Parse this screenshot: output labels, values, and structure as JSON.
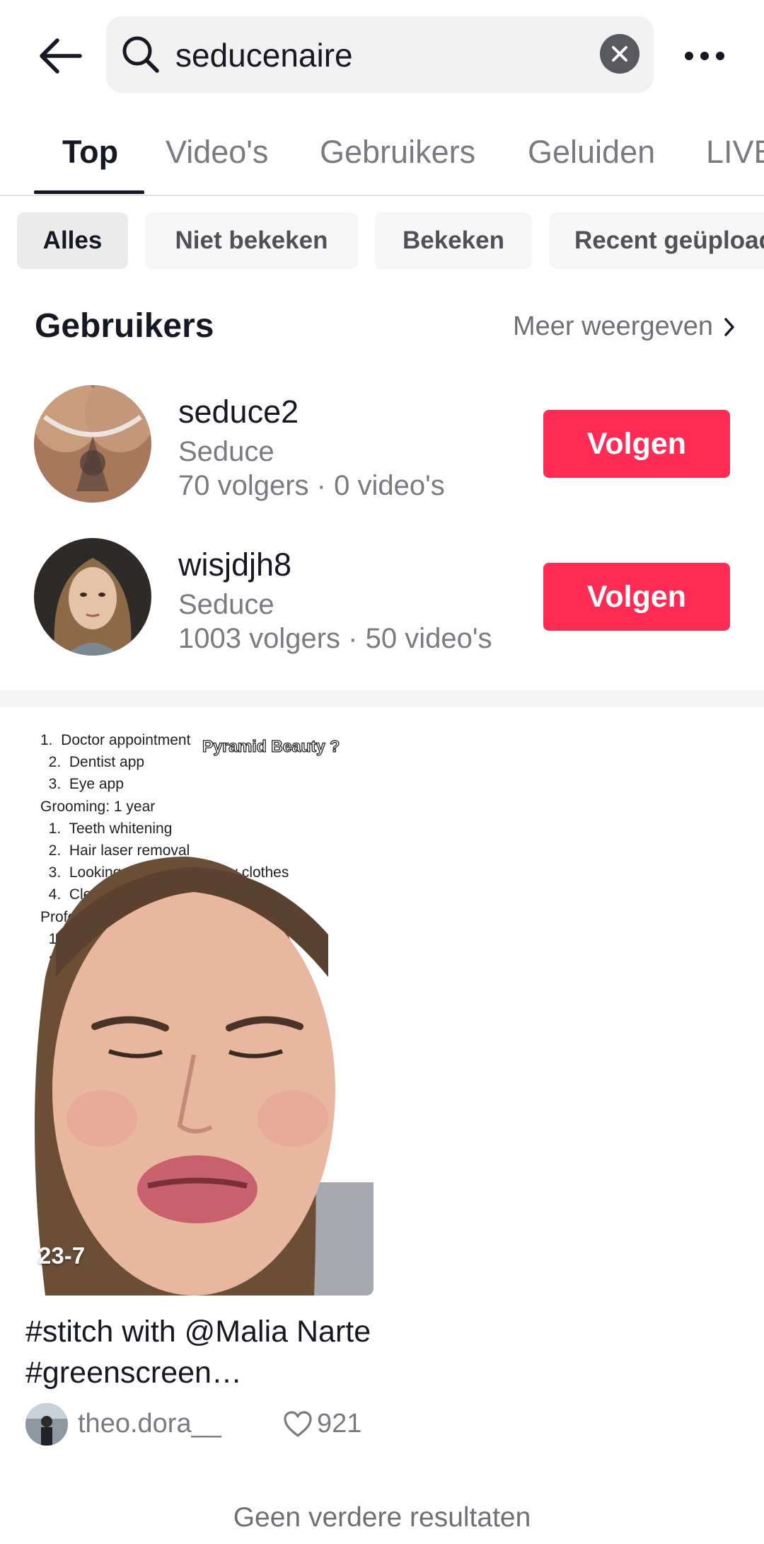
{
  "search": {
    "query": "seducenaire"
  },
  "tabs": [
    {
      "label": "Top",
      "active": true
    },
    {
      "label": "Video's",
      "active": false
    },
    {
      "label": "Gebruikers",
      "active": false
    },
    {
      "label": "Geluiden",
      "active": false
    },
    {
      "label": "LIVE",
      "active": false
    }
  ],
  "filters": [
    {
      "label": "Alles",
      "active": true
    },
    {
      "label": "Niet bekeken",
      "active": false
    },
    {
      "label": "Bekeken",
      "active": false
    },
    {
      "label": "Recent geüpload",
      "active": false
    }
  ],
  "users_section": {
    "title": "Gebruikers",
    "more_label": "Meer weergeven",
    "users": [
      {
        "username": "seduce2",
        "nickname": "Seduce",
        "stats": "70 volgers · 0 video's",
        "follow_label": "Volgen"
      },
      {
        "username": "wisjdjh8",
        "nickname": "Seduce",
        "stats": "1003 volgers · 50 video's",
        "follow_label": "Volgen"
      }
    ]
  },
  "video": {
    "notes_text": "1.  Doctor appointment\n  2.  Dentist app\n  3.  Eye app\nGrooming: 1 year\n  1.  Teeth whitening\n  2.  Hair laser removal\n  3.  Looking clean/ ironing my clothes\n  4.  Clean envir\nProfessional\n  1.  Hair\n  2.  M\n  3.\n  4.",
    "overlay_title": "Pyramid Beauty ?",
    "duration": "23-7",
    "caption": "#stitch with @Malia Narte  #greenscreen…",
    "author": "theo.dora__",
    "likes": "921"
  },
  "footer": {
    "no_more": "Geen verdere resultaten"
  },
  "colors": {
    "accent": "#fe2c55",
    "text": "#161823",
    "secondary": "#7a7b80"
  }
}
